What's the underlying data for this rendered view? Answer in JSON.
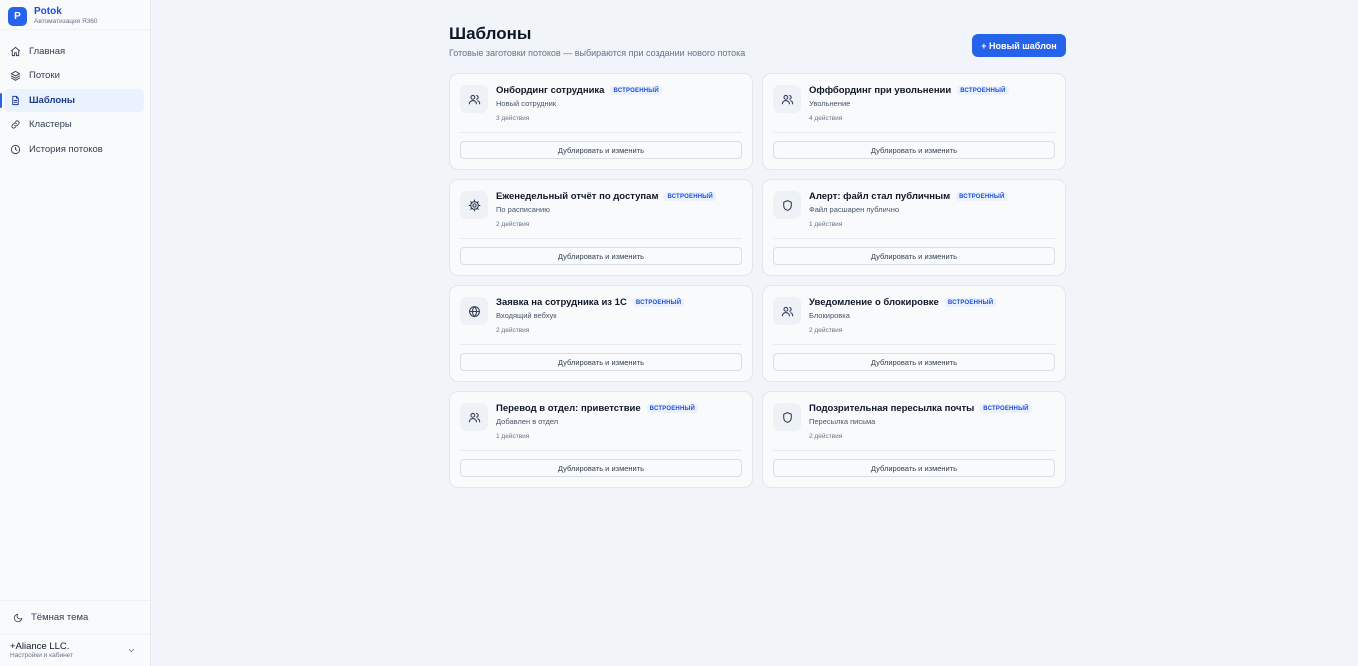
{
  "brand": {
    "logo_letter": "P",
    "name": "Potok",
    "subtitle": "Автоматизация Я360",
    "color": "#2563eb"
  },
  "nav": [
    {
      "label": "Главная",
      "icon": "home-icon",
      "active": false
    },
    {
      "label": "Потоки",
      "icon": "layers-icon",
      "active": false
    },
    {
      "label": "Шаблоны",
      "icon": "document-icon",
      "active": true
    },
    {
      "label": "Кластеры",
      "icon": "link-icon",
      "active": false
    },
    {
      "label": "История потоков",
      "icon": "clock-icon",
      "active": false
    }
  ],
  "theme_toggle": {
    "label": "Тёмная тема",
    "icon": "moon-icon"
  },
  "account": {
    "name": "+Aliance LLC.",
    "subtitle": "Настройки и кабинет"
  },
  "header": {
    "title": "Шаблоны",
    "subtitle": "Готовые заготовки потоков — выбираются при создании нового потока",
    "new_button": "+ Новый шаблон"
  },
  "templates": [
    {
      "title": "Онбординг сотрудника",
      "badge": "ВСТРОЕННЫЙ",
      "trigger": "Новый сотрудник",
      "actions": "3 действия",
      "icon": "users-icon",
      "button": "Дублировать и изменить"
    },
    {
      "title": "Оффбординг при увольнении",
      "badge": "ВСТРОЕННЫЙ",
      "trigger": "Увольнение",
      "actions": "4 действия",
      "icon": "users-icon",
      "button": "Дублировать и изменить"
    },
    {
      "title": "Еженедельный отчёт по доступам",
      "badge": "ВСТРОЕННЫЙ",
      "trigger": "По расписанию",
      "actions": "2 действия",
      "icon": "gear-icon",
      "button": "Дублировать и изменить"
    },
    {
      "title": "Алерт: файл стал публичным",
      "badge": "ВСТРОЕННЫЙ",
      "trigger": "Файл расшарен публично",
      "actions": "1 действия",
      "icon": "shield-icon",
      "button": "Дублировать и изменить"
    },
    {
      "title": "Заявка на сотрудника из 1С",
      "badge": "ВСТРОЕННЫЙ",
      "trigger": "Входящий вебхук",
      "actions": "2 действия",
      "icon": "globe-icon",
      "button": "Дублировать и изменить"
    },
    {
      "title": "Уведомление о блокировке",
      "badge": "ВСТРОЕННЫЙ",
      "trigger": "Блокировка",
      "actions": "2 действия",
      "icon": "users-icon",
      "button": "Дублировать и изменить"
    },
    {
      "title": "Перевод в отдел: приветствие",
      "badge": "ВСТРОЕННЫЙ",
      "trigger": "Добавлен в отдел",
      "actions": "1 действия",
      "icon": "users-icon",
      "button": "Дублировать и изменить"
    },
    {
      "title": "Подозрительная пересылка почты",
      "badge": "ВСТРОЕННЫЙ",
      "trigger": "Пересылка письма",
      "actions": "2 действия",
      "icon": "shield-icon",
      "button": "Дублировать и изменить"
    }
  ]
}
